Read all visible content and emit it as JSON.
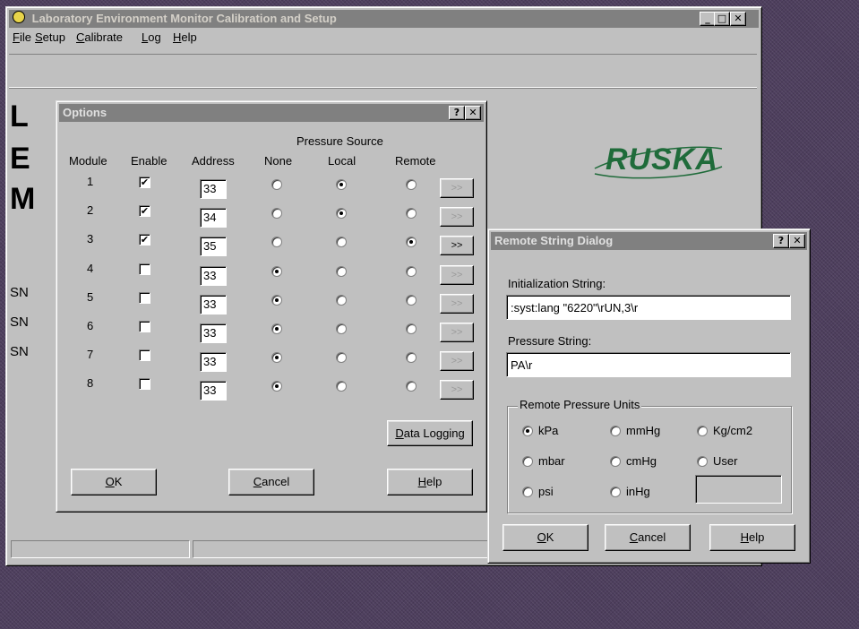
{
  "main_window": {
    "title": "Laboratory Environment Monitor Calibration and Setup",
    "menu": [
      {
        "label_u": "F",
        "label_rest": "ile"
      },
      {
        "label_u": "S",
        "label_rest": "etup"
      },
      {
        "label_u": "C",
        "label_rest": "alibrate"
      },
      {
        "label_u": "L",
        "label_rest": "og"
      },
      {
        "label_u": "H",
        "label_rest": "elp"
      }
    ],
    "background_labels": [
      "L",
      "E",
      "M"
    ],
    "sn_labels": [
      "SN",
      "SN",
      "SN"
    ],
    "logo_text": "RUSKA"
  },
  "options_dialog": {
    "title": "Options",
    "help_caption": "?",
    "close_caption": "✕",
    "headers": {
      "module": "Module",
      "enable": "Enable",
      "address": "Address",
      "pressure_source": "Pressure Source",
      "none": "None",
      "local": "Local",
      "remote": "Remote"
    },
    "rows": [
      {
        "module": "1",
        "enabled": true,
        "address": "33",
        "source": "local",
        "remote_btn": ">>",
        "remote_btn_enabled": false
      },
      {
        "module": "2",
        "enabled": true,
        "address": "34",
        "source": "local",
        "remote_btn": ">>",
        "remote_btn_enabled": false
      },
      {
        "module": "3",
        "enabled": true,
        "address": "35",
        "source": "remote",
        "remote_btn": ">>",
        "remote_btn_enabled": true
      },
      {
        "module": "4",
        "enabled": false,
        "address": "33",
        "source": "none",
        "remote_btn": ">>",
        "remote_btn_enabled": false
      },
      {
        "module": "5",
        "enabled": false,
        "address": "33",
        "source": "none",
        "remote_btn": ">>",
        "remote_btn_enabled": false
      },
      {
        "module": "6",
        "enabled": false,
        "address": "33",
        "source": "none",
        "remote_btn": ">>",
        "remote_btn_enabled": false
      },
      {
        "module": "7",
        "enabled": false,
        "address": "33",
        "source": "none",
        "remote_btn": ">>",
        "remote_btn_enabled": false
      },
      {
        "module": "8",
        "enabled": false,
        "address": "33",
        "source": "none",
        "remote_btn": ">>",
        "remote_btn_enabled": false
      }
    ],
    "data_logging": {
      "u": "D",
      "rest": "ata Logging"
    },
    "ok": {
      "u": "O",
      "rest": "K"
    },
    "cancel": {
      "u": "C",
      "rest": "ancel"
    },
    "help": {
      "u": "H",
      "rest": "elp"
    }
  },
  "remote_dialog": {
    "title": "Remote String Dialog",
    "help_caption": "?",
    "close_caption": "✕",
    "init_label": "Initialization String:",
    "init_value": ":syst:lang \"6220\"\\rUN,3\\r",
    "pressure_label": "Pressure String:",
    "pressure_value": "PA\\r",
    "units_group": "Remote Pressure Units",
    "units": [
      {
        "label": "kPa",
        "selected": true
      },
      {
        "label": "mmHg",
        "selected": false
      },
      {
        "label": "Kg/cm2",
        "selected": false
      },
      {
        "label": "mbar",
        "selected": false
      },
      {
        "label": "cmHg",
        "selected": false
      },
      {
        "label": "User",
        "selected": false
      },
      {
        "label": "psi",
        "selected": false
      },
      {
        "label": "inHg",
        "selected": false
      }
    ],
    "user_value": "",
    "ok": {
      "u": "O",
      "rest": "K"
    },
    "cancel": {
      "u": "C",
      "rest": "ancel"
    },
    "help": {
      "u": "H",
      "rest": "elp"
    }
  }
}
